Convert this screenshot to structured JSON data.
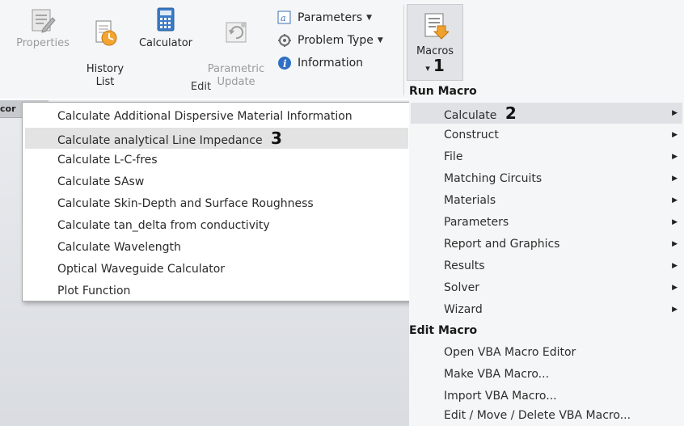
{
  "ribbon": {
    "buttons": {
      "properties": "Properties",
      "history_list": "History\nList",
      "calculator": "Calculator",
      "parametric_update": "Parametric\nUpdate"
    },
    "small_buttons": {
      "parameters": "Parameters",
      "problem_type": "Problem Type",
      "information": "Information"
    },
    "group_label": "Edit",
    "macros_label": "Macros",
    "macros_caret": "▾",
    "callout_1": "1"
  },
  "tabstrip_label": "cor",
  "calculate_submenu": {
    "items": [
      "Calculate Additional Dispersive Material Information",
      "Calculate analytical Line Impedance",
      "Calculate L-C-fres",
      "Calculate SAsw",
      "Calculate Skin-Depth and Surface Roughness",
      "Calculate tan_delta from conductivity",
      "Calculate Wavelength",
      "Optical Waveguide Calculator",
      "Plot Function"
    ],
    "callout_3": "3"
  },
  "macros_menu": {
    "run_header": "Run Macro",
    "run_items": [
      "Calculate",
      "Construct",
      "File",
      "Matching Circuits",
      "Materials",
      "Parameters",
      "Report and Graphics",
      "Results",
      "Solver",
      "Wizard"
    ],
    "callout_2": "2",
    "edit_header": "Edit Macro",
    "edit_items": [
      "Open VBA Macro Editor",
      "Make VBA Macro...",
      "Import VBA Macro...",
      "Edit / Move / Delete VBA Macro..."
    ],
    "arrow": "▶"
  },
  "colors": {
    "ribbon_bg": "#f5f6f7",
    "highlight": "#e3e3e3",
    "macros_pressed": "#e1e3e6"
  }
}
